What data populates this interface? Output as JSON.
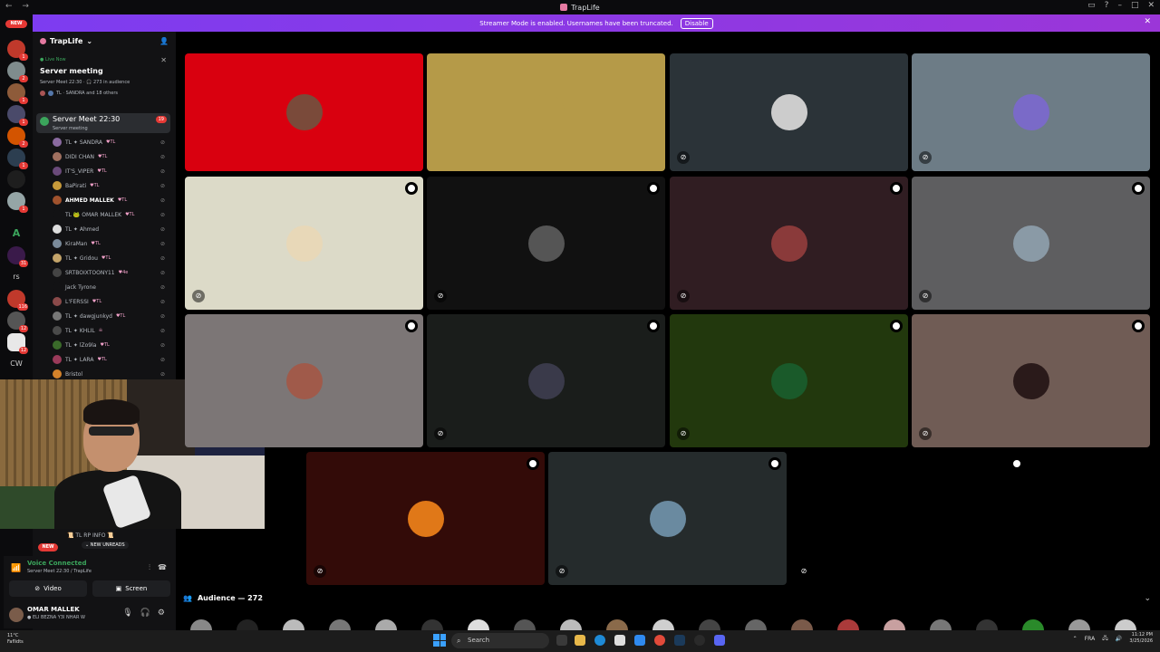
{
  "titlebar": {
    "title": "TrapLife"
  },
  "banner": {
    "text": "Streamer Mode is enabled. Usernames have been truncated.",
    "button": "Disable"
  },
  "server_rail": {
    "new_label": "NEW",
    "items": [
      {
        "name": "server-1",
        "badge": "1",
        "color": "#c0392b"
      },
      {
        "name": "server-2",
        "badge": "2",
        "color": "#7f8c8d"
      },
      {
        "name": "server-3",
        "badge": "1",
        "color": "#8e5b3a"
      },
      {
        "name": "server-4",
        "badge": "1",
        "color": "#4a4a6a"
      },
      {
        "name": "server-5",
        "badge": "2",
        "color": "#d35400"
      },
      {
        "name": "server-6",
        "badge": "1",
        "color": "#2c3e50"
      },
      {
        "name": "server-7",
        "badge": "",
        "color": "#1e1e1e"
      },
      {
        "name": "server-8",
        "badge": "1",
        "color": "#95a5a6"
      }
    ],
    "letter_a": "A",
    "badge_31": "31",
    "rs": "rs",
    "badge_116": "116",
    "badge_12a": "12",
    "badge_12b": "12",
    "cw": "CW"
  },
  "sidebar": {
    "server_name": "TrapLife",
    "live_label": "Live Now",
    "live_title": "Server meeting",
    "live_sub": "Server Meet 22:30 · 🎧 273 in audience",
    "live_sub2": "TL · SANDRA and 18 others",
    "channel": {
      "name": "Server Meet 22:30",
      "sub": "Server meeting",
      "count": "19"
    },
    "members": [
      {
        "name": "TL ✦ SANDRA",
        "tag": "♥TL",
        "color": "#8a6aa0"
      },
      {
        "name": "DIDI CHAN",
        "tag": "♥TL",
        "color": "#a07060"
      },
      {
        "name": "IT'S_VIPER",
        "tag": "♥TL",
        "color": "#6a4a7a"
      },
      {
        "name": "BaPirati",
        "tag": "♥TL",
        "color": "#c79a3a"
      },
      {
        "name": "AHMED MALLEK",
        "tag": "♥TL",
        "color": "#a0522d",
        "bold": true
      },
      {
        "name": "TL 🐸 OMAR MALLEK",
        "tag": "♥TL",
        "color": "#121214"
      },
      {
        "name": "TL ✦ Ahmed",
        "tag": "",
        "color": "#dddddd"
      },
      {
        "name": "KiraMan",
        "tag": "♥TL",
        "color": "#7a8a9a"
      },
      {
        "name": "TL ✦ Gridou",
        "tag": "♥TL",
        "color": "#c4a46a"
      },
      {
        "name": "SRTBOIXTOONY11",
        "tag": "♥4e",
        "color": "#444444"
      },
      {
        "name": "Jack Tyrone",
        "tag": "",
        "color": "#121214"
      },
      {
        "name": "L'FERSSI",
        "tag": "♥TL",
        "color": "#8a4a4a"
      },
      {
        "name": "TL ✦ dawgjunkyd",
        "tag": "♥TL",
        "color": "#777777"
      },
      {
        "name": "TL ✦ KHLIL",
        "tag": "☠",
        "color": "#4a4a4a"
      },
      {
        "name": "TL ✦ lZo9la",
        "tag": "♥TL",
        "color": "#3a6a2a"
      },
      {
        "name": "TL ✦ LARA",
        "tag": "♥TL",
        "color": "#9a3a5a"
      },
      {
        "name": "Bristol",
        "tag": "",
        "color": "#d4822a"
      }
    ]
  },
  "channel_panel": {
    "line1": "📜 TL RP INFO 📜",
    "unreads": "⌄ NEW UNREADS",
    "new_label": "NEW"
  },
  "voice": {
    "title": "Voice Connected",
    "sub": "Server Meet 22:30 / TrapLife",
    "video": "Video",
    "screen": "Screen"
  },
  "user": {
    "name": "OMAR MALLEK",
    "status": "● ELI BEZNA Y3I NHAR W"
  },
  "tiles": [
    {
      "bg": "#d9000f",
      "avatar": "#7a4a3a",
      "muted": false,
      "settings": false
    },
    {
      "bg": "#b59a48",
      "avatar": "#b59a48",
      "muted": false,
      "settings": false
    },
    {
      "bg": "#2b3338",
      "avatar": "#cccccc",
      "muted": true,
      "settings": false
    },
    {
      "bg": "#6d7c86",
      "avatar": "#7a6ac8",
      "muted": true,
      "settings": false
    },
    {
      "bg": "#dcdac8",
      "avatar": "#e8d8b8",
      "muted": true,
      "settings": true
    },
    {
      "bg": "#111111",
      "avatar": "#555555",
      "muted": true,
      "settings": true
    },
    {
      "bg": "#301d22",
      "avatar": "#8a3a3a",
      "muted": true,
      "settings": true
    },
    {
      "bg": "#5e5e60",
      "avatar": "#8a9aa6",
      "muted": true,
      "settings": true
    },
    {
      "bg": "#7c7676",
      "avatar": "#a05a4a",
      "muted": false,
      "settings": true
    },
    {
      "bg": "#1a1d1b",
      "avatar": "#3a3a4a",
      "muted": true,
      "settings": true
    },
    {
      "bg": "#22380d",
      "avatar": "#1a5a2a",
      "muted": true,
      "settings": true
    },
    {
      "bg": "#705c55",
      "avatar": "#2a1a1a",
      "muted": true,
      "settings": true
    },
    {
      "bg": "#330b08",
      "avatar": "#e07818",
      "muted": true,
      "settings": true
    },
    {
      "bg": "#252b2c",
      "avatar": "#6a8aa0",
      "muted": true,
      "settings": true
    },
    {
      "bg": "#000000",
      "avatar": "#000000",
      "muted": true,
      "settings": true
    }
  ],
  "audience": {
    "label": "Audience — 272"
  },
  "taskbar": {
    "weather_temp": "11°C",
    "weather_desc": "Faflidts",
    "search": "Search",
    "lang": "FRA",
    "time": "11:12 PM",
    "date": "3/25/2026"
  },
  "colors": {
    "banner": "#8f3ae6",
    "accent_green": "#3ba55c",
    "badge_red": "#e53935"
  },
  "icons": {
    "mute": "mic-off-icon",
    "settings": "settings-icon",
    "search": "search-icon",
    "gear": "gear-icon"
  }
}
